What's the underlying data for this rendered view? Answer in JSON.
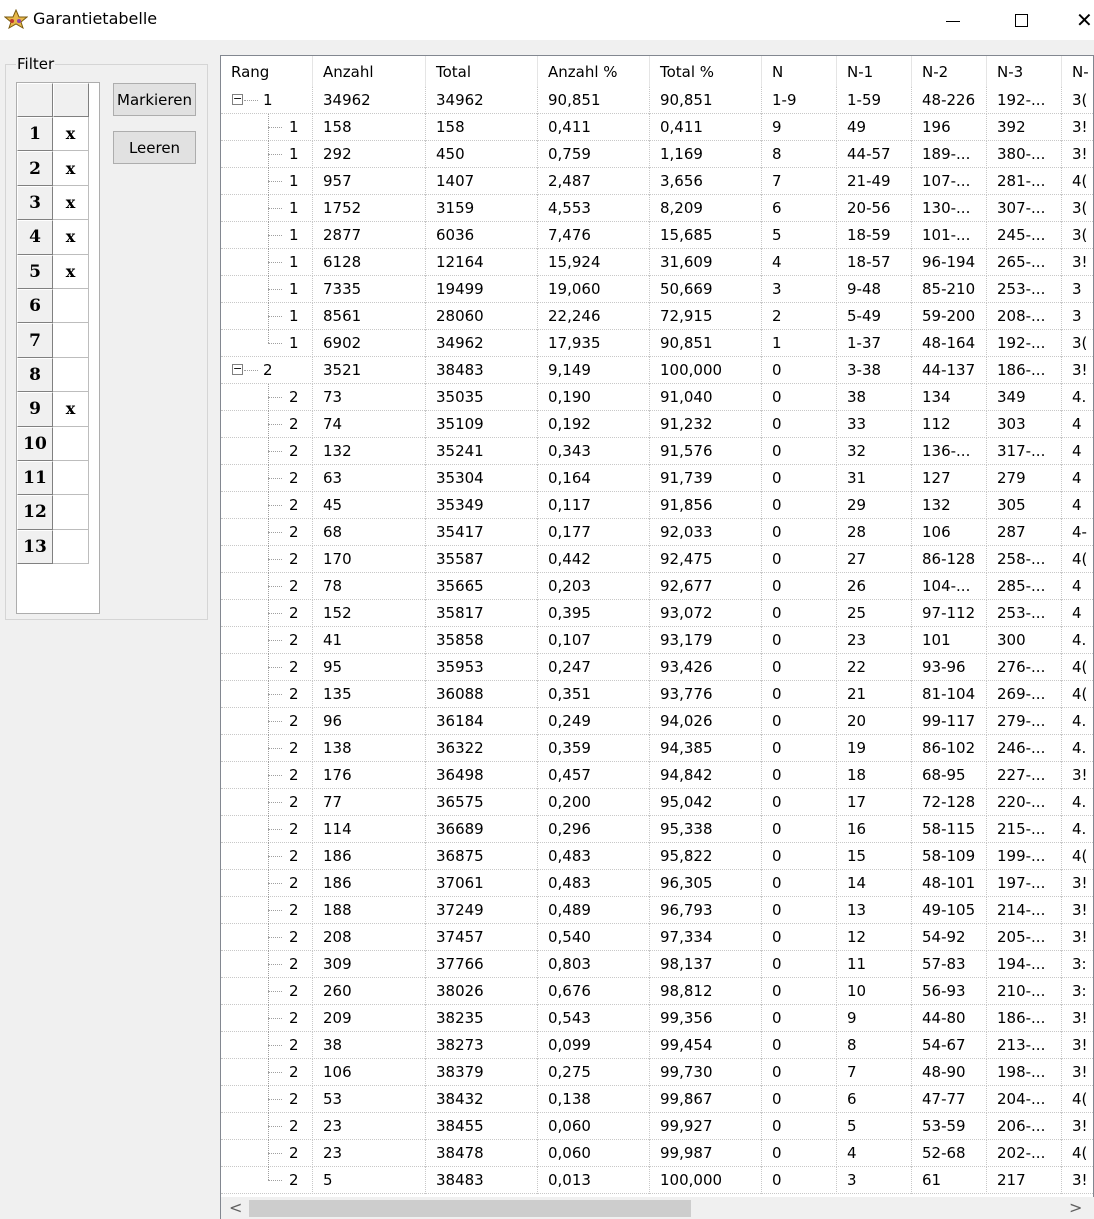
{
  "window": {
    "title": "Garantietabelle",
    "close_glyph": "✕"
  },
  "filter": {
    "legend": "Filter",
    "rows": [
      {
        "num": "1",
        "mark": "x"
      },
      {
        "num": "2",
        "mark": "x"
      },
      {
        "num": "3",
        "mark": "x"
      },
      {
        "num": "4",
        "mark": "x"
      },
      {
        "num": "5",
        "mark": "x"
      },
      {
        "num": "6",
        "mark": ""
      },
      {
        "num": "7",
        "mark": ""
      },
      {
        "num": "8",
        "mark": ""
      },
      {
        "num": "9",
        "mark": "x"
      },
      {
        "num": "10",
        "mark": ""
      },
      {
        "num": "11",
        "mark": ""
      },
      {
        "num": "12",
        "mark": ""
      },
      {
        "num": "13",
        "mark": ""
      }
    ],
    "mark_button": "Markieren",
    "clear_button": "Leeren"
  },
  "table": {
    "columns": [
      "Rang",
      "Anzahl",
      "Total",
      "Anzahl %",
      "Total %",
      "N",
      "N-1",
      "N-2",
      "N-3",
      "N-"
    ],
    "rows": [
      {
        "level": 0,
        "expander": "−",
        "cells": [
          "1",
          "34962",
          "34962",
          "90,851",
          "90,851",
          "1-9",
          "1-59",
          "48-226",
          "192-...",
          "3("
        ]
      },
      {
        "level": 1,
        "cells": [
          "1",
          "158",
          "158",
          "0,411",
          "0,411",
          "9",
          "49",
          "196",
          "392",
          "3!"
        ]
      },
      {
        "level": 1,
        "cells": [
          "1",
          "292",
          "450",
          "0,759",
          "1,169",
          "8",
          "44-57",
          "189-...",
          "380-...",
          "3!"
        ]
      },
      {
        "level": 1,
        "cells": [
          "1",
          "957",
          "1407",
          "2,487",
          "3,656",
          "7",
          "21-49",
          "107-...",
          "281-...",
          "4("
        ]
      },
      {
        "level": 1,
        "cells": [
          "1",
          "1752",
          "3159",
          "4,553",
          "8,209",
          "6",
          "20-56",
          "130-...",
          "307-...",
          "3("
        ]
      },
      {
        "level": 1,
        "cells": [
          "1",
          "2877",
          "6036",
          "7,476",
          "15,685",
          "5",
          "18-59",
          "101-...",
          "245-...",
          "3("
        ]
      },
      {
        "level": 1,
        "cells": [
          "1",
          "6128",
          "12164",
          "15,924",
          "31,609",
          "4",
          "18-57",
          "96-194",
          "265-...",
          "3!"
        ]
      },
      {
        "level": 1,
        "cells": [
          "1",
          "7335",
          "19499",
          "19,060",
          "50,669",
          "3",
          "9-48",
          "85-210",
          "253-...",
          "3"
        ]
      },
      {
        "level": 1,
        "cells": [
          "1",
          "8561",
          "28060",
          "22,246",
          "72,915",
          "2",
          "5-49",
          "59-200",
          "208-...",
          "3"
        ]
      },
      {
        "level": 1,
        "last": true,
        "cells": [
          "1",
          "6902",
          "34962",
          "17,935",
          "90,851",
          "1",
          "1-37",
          "48-164",
          "192-...",
          "3("
        ]
      },
      {
        "level": 0,
        "expander": "−",
        "cells": [
          "2",
          "3521",
          "38483",
          "9,149",
          "100,000",
          "0",
          "3-38",
          "44-137",
          "186-...",
          "3!"
        ]
      },
      {
        "level": 1,
        "cells": [
          "2",
          "73",
          "35035",
          "0,190",
          "91,040",
          "0",
          "38",
          "134",
          "349",
          "4."
        ]
      },
      {
        "level": 1,
        "cells": [
          "2",
          "74",
          "35109",
          "0,192",
          "91,232",
          "0",
          "33",
          "112",
          "303",
          "4"
        ]
      },
      {
        "level": 1,
        "cells": [
          "2",
          "132",
          "35241",
          "0,343",
          "91,576",
          "0",
          "32",
          "136-...",
          "317-...",
          "4"
        ]
      },
      {
        "level": 1,
        "cells": [
          "2",
          "63",
          "35304",
          "0,164",
          "91,739",
          "0",
          "31",
          "127",
          "279",
          "4"
        ]
      },
      {
        "level": 1,
        "cells": [
          "2",
          "45",
          "35349",
          "0,117",
          "91,856",
          "0",
          "29",
          "132",
          "305",
          "4"
        ]
      },
      {
        "level": 1,
        "cells": [
          "2",
          "68",
          "35417",
          "0,177",
          "92,033",
          "0",
          "28",
          "106",
          "287",
          "4-"
        ]
      },
      {
        "level": 1,
        "cells": [
          "2",
          "170",
          "35587",
          "0,442",
          "92,475",
          "0",
          "27",
          "86-128",
          "258-...",
          "4("
        ]
      },
      {
        "level": 1,
        "cells": [
          "2",
          "78",
          "35665",
          "0,203",
          "92,677",
          "0",
          "26",
          "104-...",
          "285-...",
          "4"
        ]
      },
      {
        "level": 1,
        "cells": [
          "2",
          "152",
          "35817",
          "0,395",
          "93,072",
          "0",
          "25",
          "97-112",
          "253-...",
          "4"
        ]
      },
      {
        "level": 1,
        "cells": [
          "2",
          "41",
          "35858",
          "0,107",
          "93,179",
          "0",
          "23",
          "101",
          "300",
          "4."
        ]
      },
      {
        "level": 1,
        "cells": [
          "2",
          "95",
          "35953",
          "0,247",
          "93,426",
          "0",
          "22",
          "93-96",
          "276-...",
          "4("
        ]
      },
      {
        "level": 1,
        "cells": [
          "2",
          "135",
          "36088",
          "0,351",
          "93,776",
          "0",
          "21",
          "81-104",
          "269-...",
          "4("
        ]
      },
      {
        "level": 1,
        "cells": [
          "2",
          "96",
          "36184",
          "0,249",
          "94,026",
          "0",
          "20",
          "99-117",
          "279-...",
          "4."
        ]
      },
      {
        "level": 1,
        "cells": [
          "2",
          "138",
          "36322",
          "0,359",
          "94,385",
          "0",
          "19",
          "86-102",
          "246-...",
          "4."
        ]
      },
      {
        "level": 1,
        "cells": [
          "2",
          "176",
          "36498",
          "0,457",
          "94,842",
          "0",
          "18",
          "68-95",
          "227-...",
          "3!"
        ]
      },
      {
        "level": 1,
        "cells": [
          "2",
          "77",
          "36575",
          "0,200",
          "95,042",
          "0",
          "17",
          "72-128",
          "220-...",
          "4."
        ]
      },
      {
        "level": 1,
        "cells": [
          "2",
          "114",
          "36689",
          "0,296",
          "95,338",
          "0",
          "16",
          "58-115",
          "215-...",
          "4."
        ]
      },
      {
        "level": 1,
        "cells": [
          "2",
          "186",
          "36875",
          "0,483",
          "95,822",
          "0",
          "15",
          "58-109",
          "199-...",
          "4("
        ]
      },
      {
        "level": 1,
        "cells": [
          "2",
          "186",
          "37061",
          "0,483",
          "96,305",
          "0",
          "14",
          "48-101",
          "197-...",
          "3!"
        ]
      },
      {
        "level": 1,
        "cells": [
          "2",
          "188",
          "37249",
          "0,489",
          "96,793",
          "0",
          "13",
          "49-105",
          "214-...",
          "3!"
        ]
      },
      {
        "level": 1,
        "cells": [
          "2",
          "208",
          "37457",
          "0,540",
          "97,334",
          "0",
          "12",
          "54-92",
          "205-...",
          "3!"
        ]
      },
      {
        "level": 1,
        "cells": [
          "2",
          "309",
          "37766",
          "0,803",
          "98,137",
          "0",
          "11",
          "57-83",
          "194-...",
          "3:"
        ]
      },
      {
        "level": 1,
        "cells": [
          "2",
          "260",
          "38026",
          "0,676",
          "98,812",
          "0",
          "10",
          "56-93",
          "210-...",
          "3:"
        ]
      },
      {
        "level": 1,
        "cells": [
          "2",
          "209",
          "38235",
          "0,543",
          "99,356",
          "0",
          "9",
          "44-80",
          "186-...",
          "3!"
        ]
      },
      {
        "level": 1,
        "cells": [
          "2",
          "38",
          "38273",
          "0,099",
          "99,454",
          "0",
          "8",
          "54-67",
          "213-...",
          "3!"
        ]
      },
      {
        "level": 1,
        "cells": [
          "2",
          "106",
          "38379",
          "0,275",
          "99,730",
          "0",
          "7",
          "48-90",
          "198-...",
          "3!"
        ]
      },
      {
        "level": 1,
        "cells": [
          "2",
          "53",
          "38432",
          "0,138",
          "99,867",
          "0",
          "6",
          "47-77",
          "204-...",
          "4("
        ]
      },
      {
        "level": 1,
        "cells": [
          "2",
          "23",
          "38455",
          "0,060",
          "99,927",
          "0",
          "5",
          "53-59",
          "206-...",
          "3!"
        ]
      },
      {
        "level": 1,
        "cells": [
          "2",
          "23",
          "38478",
          "0,060",
          "99,987",
          "0",
          "4",
          "52-68",
          "202-...",
          "4("
        ]
      },
      {
        "level": 1,
        "last": true,
        "cells": [
          "2",
          "5",
          "38483",
          "0,013",
          "100,000",
          "0",
          "3",
          "61",
          "217",
          "3!"
        ]
      }
    ]
  },
  "scrollbar": {
    "left_arrow": "<",
    "right_arrow": ">"
  }
}
